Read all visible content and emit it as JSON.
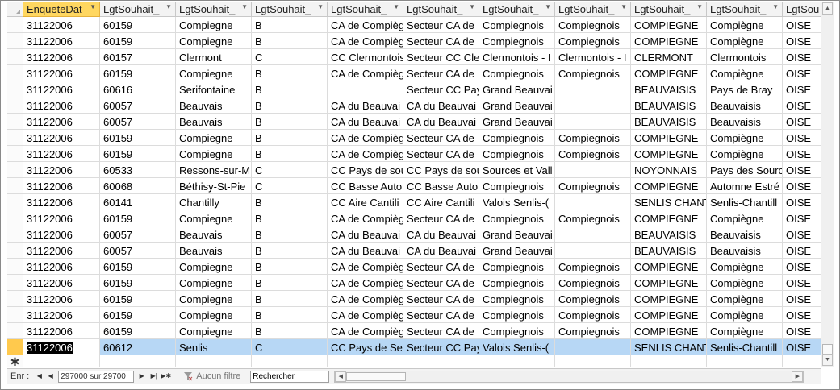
{
  "columns": [
    {
      "label": "EnqueteDat",
      "width": 95,
      "active": true
    },
    {
      "label": "LgtSouhait_",
      "width": 94
    },
    {
      "label": "LgtSouhait_",
      "width": 94
    },
    {
      "label": "LgtSouhait_",
      "width": 94
    },
    {
      "label": "LgtSouhait_",
      "width": 94
    },
    {
      "label": "LgtSouhait_",
      "width": 94
    },
    {
      "label": "LgtSouhait_",
      "width": 94
    },
    {
      "label": "LgtSouhait_",
      "width": 94
    },
    {
      "label": "LgtSouhait_",
      "width": 94
    },
    {
      "label": "LgtSouhait_",
      "width": 94
    },
    {
      "label": "LgtSou",
      "width": 60
    }
  ],
  "rows": [
    [
      "31122006",
      "60159",
      "Compiegne",
      "B",
      "CA de Compièg",
      "Secteur CA de",
      "Compiegnois",
      "Compiegnois",
      "COMPIEGNE",
      "Compiègne",
      "OISE"
    ],
    [
      "31122006",
      "60159",
      "Compiegne",
      "B",
      "CA de Compièg",
      "Secteur CA de",
      "Compiegnois",
      "Compiegnois",
      "COMPIEGNE",
      "Compiègne",
      "OISE"
    ],
    [
      "31122006",
      "60157",
      "Clermont",
      "C",
      "CC Clermontois",
      "Secteur CC Cle",
      "Clermontois - I",
      "Clermontois - I",
      "CLERMONT",
      "Clermontois",
      "OISE"
    ],
    [
      "31122006",
      "60159",
      "Compiegne",
      "B",
      "CA de Compièg",
      "Secteur CA de",
      "Compiegnois",
      "Compiegnois",
      "COMPIEGNE",
      "Compiègne",
      "OISE"
    ],
    [
      "31122006",
      "60616",
      "Serifontaine",
      "B",
      "",
      "Secteur CC Pay",
      "Grand Beauvai",
      "",
      "BEAUVAISIS",
      "Pays de Bray",
      "OISE"
    ],
    [
      "31122006",
      "60057",
      "Beauvais",
      "B",
      "CA du Beauvai",
      "CA du Beauvai",
      "Grand Beauvai",
      "",
      "BEAUVAISIS",
      "Beauvaisis",
      "OISE"
    ],
    [
      "31122006",
      "60057",
      "Beauvais",
      "B",
      "CA du Beauvai",
      "CA du Beauvai",
      "Grand Beauvai",
      "",
      "BEAUVAISIS",
      "Beauvaisis",
      "OISE"
    ],
    [
      "31122006",
      "60159",
      "Compiegne",
      "B",
      "CA de Compièg",
      "Secteur CA de",
      "Compiegnois",
      "Compiegnois",
      "COMPIEGNE",
      "Compiègne",
      "OISE"
    ],
    [
      "31122006",
      "60159",
      "Compiegne",
      "B",
      "CA de Compièg",
      "Secteur CA de",
      "Compiegnois",
      "Compiegnois",
      "COMPIEGNE",
      "Compiègne",
      "OISE"
    ],
    [
      "31122006",
      "60533",
      "Ressons-sur-M",
      "C",
      "CC Pays de sou",
      "CC Pays de sou",
      "Sources et Vall",
      "",
      "NOYONNAIS",
      "Pays des Sourc",
      "OISE"
    ],
    [
      "31122006",
      "60068",
      "Béthisy-St-Pie",
      "C",
      "CC Basse Autor",
      "CC Basse Autor",
      "Compiegnois",
      "Compiegnois",
      "COMPIEGNE",
      "Automne Estré",
      "OISE"
    ],
    [
      "31122006",
      "60141",
      "Chantilly",
      "B",
      "CC Aire Cantili",
      "CC Aire Cantili",
      "Valois  Senlis-(",
      "",
      "SENLIS CHANTI",
      "Senlis-Chantill",
      "OISE"
    ],
    [
      "31122006",
      "60159",
      "Compiegne",
      "B",
      "CA de Compièg",
      "Secteur CA de",
      "Compiegnois",
      "Compiegnois",
      "COMPIEGNE",
      "Compiègne",
      "OISE"
    ],
    [
      "31122006",
      "60057",
      "Beauvais",
      "B",
      "CA du Beauvai",
      "CA du Beauvai",
      "Grand Beauvai",
      "",
      "BEAUVAISIS",
      "Beauvaisis",
      "OISE"
    ],
    [
      "31122006",
      "60057",
      "Beauvais",
      "B",
      "CA du Beauvai",
      "CA du Beauvai",
      "Grand Beauvai",
      "",
      "BEAUVAISIS",
      "Beauvaisis",
      "OISE"
    ],
    [
      "31122006",
      "60159",
      "Compiegne",
      "B",
      "CA de Compièg",
      "Secteur CA de",
      "Compiegnois",
      "Compiegnois",
      "COMPIEGNE",
      "Compiègne",
      "OISE"
    ],
    [
      "31122006",
      "60159",
      "Compiegne",
      "B",
      "CA de Compièg",
      "Secteur CA de",
      "Compiegnois",
      "Compiegnois",
      "COMPIEGNE",
      "Compiègne",
      "OISE"
    ],
    [
      "31122006",
      "60159",
      "Compiegne",
      "B",
      "CA de Compièg",
      "Secteur CA de",
      "Compiegnois",
      "Compiegnois",
      "COMPIEGNE",
      "Compiègne",
      "OISE"
    ],
    [
      "31122006",
      "60159",
      "Compiegne",
      "B",
      "CA de Compièg",
      "Secteur CA de",
      "Compiegnois",
      "Compiegnois",
      "COMPIEGNE",
      "Compiègne",
      "OISE"
    ],
    [
      "31122006",
      "60159",
      "Compiegne",
      "B",
      "CA de Compièg",
      "Secteur CA de",
      "Compiegnois",
      "Compiegnois",
      "COMPIEGNE",
      "Compiègne",
      "OISE"
    ],
    [
      "31122006",
      "60612",
      "Senlis",
      "C",
      "CC Pays de Sen",
      "Secteur CC Pay",
      "Valois  Senlis-(",
      "",
      "SENLIS CHANTI",
      "Senlis-Chantill",
      "OISE"
    ]
  ],
  "selected_row_index": 20,
  "new_row_marker": "✱",
  "navigation": {
    "record_label": "Enr :",
    "record_value": "297000 sur 29700",
    "filter_label": "Aucun filtre",
    "search_label": "Rechercher"
  },
  "colors": {
    "active_header": "#ffd760",
    "selected_row": "#b7d7f5",
    "current_row_selector": "#ffc94d"
  }
}
